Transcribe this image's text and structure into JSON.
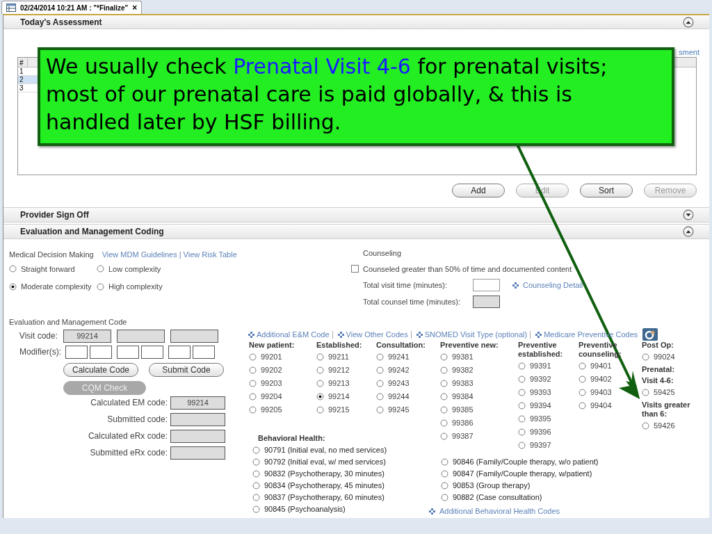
{
  "tab": {
    "title": "02/24/2014 10:21 AM : \"*Finalize\"",
    "close": "×"
  },
  "assessment": {
    "title": "Today's Assessment",
    "expanded": true,
    "link": "sment",
    "columns": [
      "#"
    ],
    "rows": [
      {
        "cells": [
          "1"
        ],
        "selected": false
      },
      {
        "cells": [
          "2"
        ],
        "selected": true
      },
      {
        "cells": [
          "3"
        ],
        "selected": false
      }
    ],
    "buttons": [
      {
        "label": "Add",
        "disabled": false
      },
      {
        "label": "Edit",
        "disabled": true
      },
      {
        "label": "Sort",
        "disabled": false
      },
      {
        "label": "Remove",
        "disabled": true
      }
    ]
  },
  "sections": [
    {
      "title": "Provider Sign Off",
      "expanded": false
    },
    {
      "title": "Evaluation and Management Coding",
      "expanded": true
    }
  ],
  "mdm": {
    "label": "Medical Decision Making",
    "links": [
      "View MDM Guidelines",
      "View Risk Table"
    ],
    "separator": "|",
    "options": [
      {
        "label": "Straight forward",
        "selected": false
      },
      {
        "label": "Low complexity",
        "selected": false
      },
      {
        "label": "Moderate complexity",
        "selected": true
      },
      {
        "label": "High complexity",
        "selected": false
      }
    ]
  },
  "counseling": {
    "title": "Counseling",
    "checkbox": {
      "label": "Counseled greater than 50% of time and documented content",
      "checked": false
    },
    "fields": [
      {
        "label": "Total visit time (minutes):",
        "disabled": false
      },
      {
        "label": "Total counsel time (minutes):",
        "disabled": true
      }
    ],
    "detail_link": "Counseling Detail"
  },
  "em_code": {
    "title": "Evaluation and Management Code",
    "visit_label": "Visit code:",
    "visit_values": [
      "99214"
    ],
    "modifier_label": "Modifier(s):",
    "buttons": [
      {
        "label": "Calculate Code",
        "disabled": false
      },
      {
        "label": "Submit Code",
        "disabled": false
      },
      {
        "label": "CQM Check",
        "disabled": true
      }
    ],
    "results": [
      {
        "label": "Calculated EM code:",
        "value": "99214"
      },
      {
        "label": "Submitted code:"
      },
      {
        "label": "Calculated eRx code:"
      },
      {
        "label": "Submitted eRx code:"
      }
    ]
  },
  "code_links": [
    "Additional E&M Code",
    "View Other Codes",
    "SNOMED Visit Type (optional)",
    "Medicare Preventive Codes"
  ],
  "code_columns": [
    {
      "items": [
        {
          "kind": "heading",
          "text": "New patient:"
        },
        {
          "kind": "option",
          "text": "99201",
          "selected": false
        },
        {
          "kind": "option",
          "text": "99202",
          "selected": false
        },
        {
          "kind": "option",
          "text": "99203",
          "selected": false
        },
        {
          "kind": "option",
          "text": "99204",
          "selected": false
        },
        {
          "kind": "option",
          "text": "99205",
          "selected": false
        }
      ]
    },
    {
      "items": [
        {
          "kind": "heading",
          "text": "Established:"
        },
        {
          "kind": "option",
          "text": "99211",
          "selected": false
        },
        {
          "kind": "option",
          "text": "99212",
          "selected": false
        },
        {
          "kind": "option",
          "text": "99213",
          "selected": false
        },
        {
          "kind": "option",
          "text": "99214",
          "selected": true
        },
        {
          "kind": "option",
          "text": "99215",
          "selected": false
        }
      ]
    },
    {
      "items": [
        {
          "kind": "heading",
          "text": "Consultation:"
        },
        {
          "kind": "option",
          "text": "99241",
          "selected": false
        },
        {
          "kind": "option",
          "text": "99242",
          "selected": false
        },
        {
          "kind": "option",
          "text": "99243",
          "selected": false
        },
        {
          "kind": "option",
          "text": "99244",
          "selected": false
        },
        {
          "kind": "option",
          "text": "99245",
          "selected": false
        }
      ]
    },
    {
      "items": [
        {
          "kind": "heading",
          "text": "Preventive new:"
        },
        {
          "kind": "option",
          "text": "99381",
          "selected": false
        },
        {
          "kind": "option",
          "text": "99382",
          "selected": false
        },
        {
          "kind": "option",
          "text": "99383",
          "selected": false
        },
        {
          "kind": "option",
          "text": "99384",
          "selected": false
        },
        {
          "kind": "option",
          "text": "99385",
          "selected": false
        },
        {
          "kind": "option",
          "text": "99386",
          "selected": false
        },
        {
          "kind": "option",
          "text": "99387",
          "selected": false
        }
      ]
    },
    {
      "items": [
        {
          "kind": "heading",
          "text": "Preventive established:"
        },
        {
          "kind": "option",
          "text": "99391",
          "selected": false
        },
        {
          "kind": "option",
          "text": "99392",
          "selected": false
        },
        {
          "kind": "option",
          "text": "99393",
          "selected": false
        },
        {
          "kind": "option",
          "text": "99394",
          "selected": false
        },
        {
          "kind": "option",
          "text": "99395",
          "selected": false
        },
        {
          "kind": "option",
          "text": "99396",
          "selected": false
        },
        {
          "kind": "option",
          "text": "99397",
          "selected": false
        }
      ]
    },
    {
      "items": [
        {
          "kind": "heading",
          "text": "Preventive counseling:"
        },
        {
          "kind": "option",
          "text": "99401",
          "selected": false
        },
        {
          "kind": "option",
          "text": "99402",
          "selected": false
        },
        {
          "kind": "option",
          "text": "99403",
          "selected": false
        },
        {
          "kind": "option",
          "text": "99404",
          "selected": false
        }
      ]
    },
    {
      "items": [
        {
          "kind": "heading",
          "text": "Post Op:"
        },
        {
          "kind": "option",
          "text": "99024",
          "selected": false
        },
        {
          "kind": "heading",
          "text": "Prenatal:"
        },
        {
          "kind": "heading",
          "text": "Visit 4-6:"
        },
        {
          "kind": "option",
          "text": "59425",
          "selected": false
        },
        {
          "kind": "heading",
          "text": "Visits greater than 6:"
        },
        {
          "kind": "option",
          "text": "59426",
          "selected": false
        }
      ]
    }
  ],
  "behavioral": {
    "title": "Behavioral Health:",
    "left": [
      {
        "text": "90791 (Initial eval, no med services)",
        "selected": false
      },
      {
        "text": "90792 (Initial eval, w/ med services)",
        "selected": false
      },
      {
        "text": "90832 (Psychotherapy, 30 minutes)",
        "selected": false
      },
      {
        "text": "90834 (Psychotherapy, 45 minutes)",
        "selected": false
      },
      {
        "text": "90837 (Psychotherapy, 60 minutes)",
        "selected": false
      },
      {
        "text": "90845 (Psychoanalysis)",
        "selected": false
      }
    ],
    "right": [
      {
        "text": "90846 (Family/Couple therapy, w/o patient)",
        "selected": false
      },
      {
        "text": "90847 (Family/Couple therapy, w/patient)",
        "selected": false
      },
      {
        "text": "90853 (Group therapy)",
        "selected": false
      },
      {
        "text": "90882 (Case consultation)",
        "selected": false
      }
    ],
    "link": "Additional Behavioral Health Codes"
  },
  "callout": {
    "parts": [
      {
        "text": "We usually check ",
        "highlighted": false
      },
      {
        "text": "Prenatal Visit 4-6",
        "highlighted": true
      },
      {
        "text": " for prenatal visits; most of our prenatal care is paid globally, & this is handled later by HSF billing.",
        "highlighted": false
      }
    ]
  }
}
